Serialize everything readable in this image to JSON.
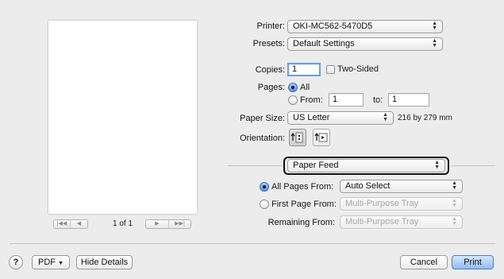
{
  "printer": {
    "label": "Printer:",
    "value": "OKI-MC562-5470D5"
  },
  "presets": {
    "label": "Presets:",
    "value": "Default Settings"
  },
  "copies": {
    "label": "Copies:",
    "value": "1",
    "two_sided_label": "Two-Sided"
  },
  "pages": {
    "label": "Pages:",
    "all_label": "All",
    "from_label": "From:",
    "from_value": "1",
    "to_label": "to:",
    "to_value": "1"
  },
  "paper_size": {
    "label": "Paper Size:",
    "value": "US Letter",
    "dimensions": "216 by 279 mm"
  },
  "orientation": {
    "label": "Orientation:"
  },
  "section": {
    "value": "Paper Feed"
  },
  "feed": {
    "all_pages_label": "All Pages From:",
    "all_pages_value": "Auto Select",
    "first_page_label": "First Page From:",
    "first_page_value": "Multi-Purpose Tray",
    "remaining_label": "Remaining From:",
    "remaining_value": "Multi-Purpose Tray"
  },
  "preview_nav": {
    "page_indicator": "1 of 1"
  },
  "footer": {
    "help": "?",
    "pdf_label": "PDF",
    "hide_details": "Hide Details",
    "cancel": "Cancel",
    "print": "Print"
  }
}
